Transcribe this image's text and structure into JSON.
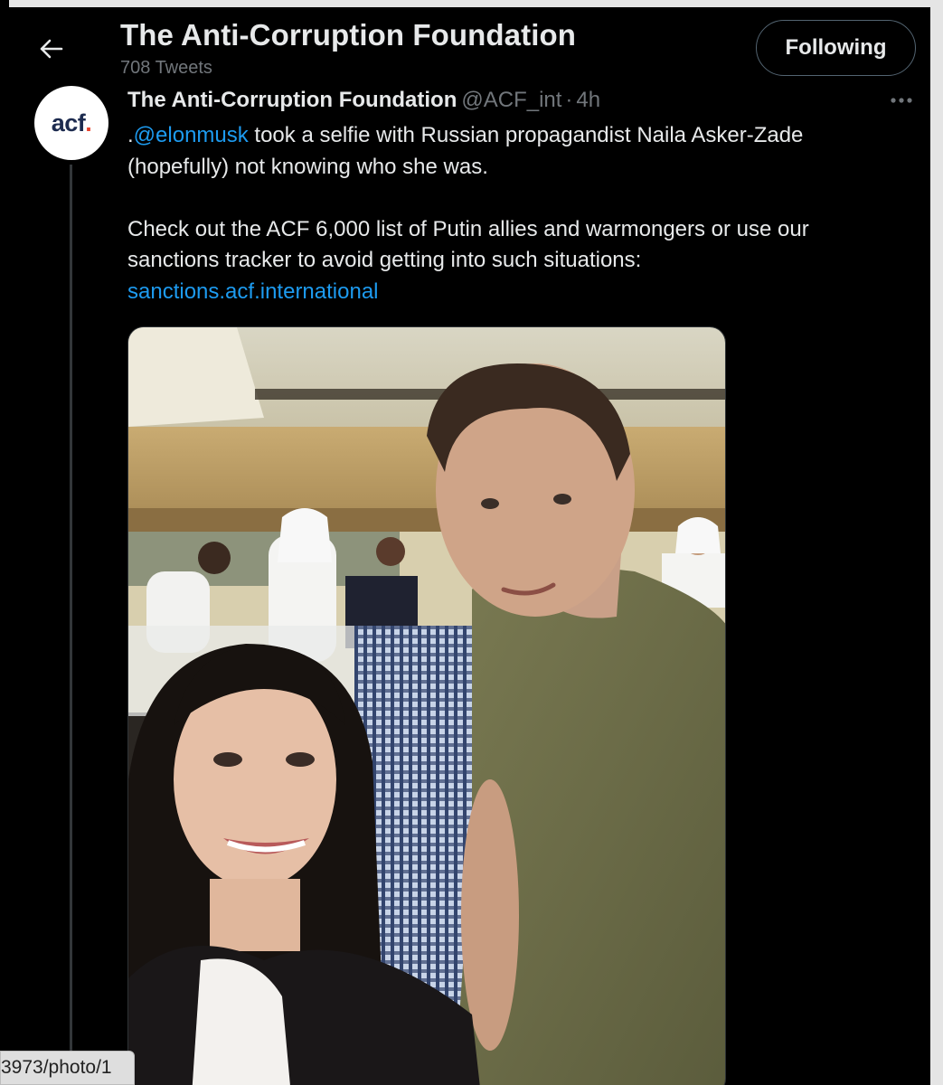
{
  "header": {
    "title": "The Anti-Corruption Foundation",
    "tweet_count": "708 Tweets",
    "follow_label": "Following",
    "back_icon": "arrow-left-icon"
  },
  "tweet": {
    "avatar_text": "acf",
    "avatar_dot": ".",
    "author_name": "The Anti-Corruption Foundation",
    "author_handle": "@ACF_int",
    "separator": "·",
    "time": "4h",
    "more_icon": "more-dots-icon",
    "line1_prefix": ".",
    "mention": "@elonmusk",
    "line1_rest": " took a selfie with Russian propagandist Naila Asker-Zade",
    "line2": "(hopefully) not knowing who she was.",
    "line3": "Check out the ACF 6,000 list of Putin allies and warmongers or use our",
    "line4": "sanctions tracker to avoid getting into such situations:",
    "link": "sanctions.acf.international"
  },
  "status_bar": {
    "url": "3973/photo/1"
  },
  "colors": {
    "background": "#000000",
    "text": "#e7e9ea",
    "muted": "#71767b",
    "link": "#1d9bf0",
    "brand_dot": "#e8432d",
    "brand_text": "#1d2b4f"
  }
}
